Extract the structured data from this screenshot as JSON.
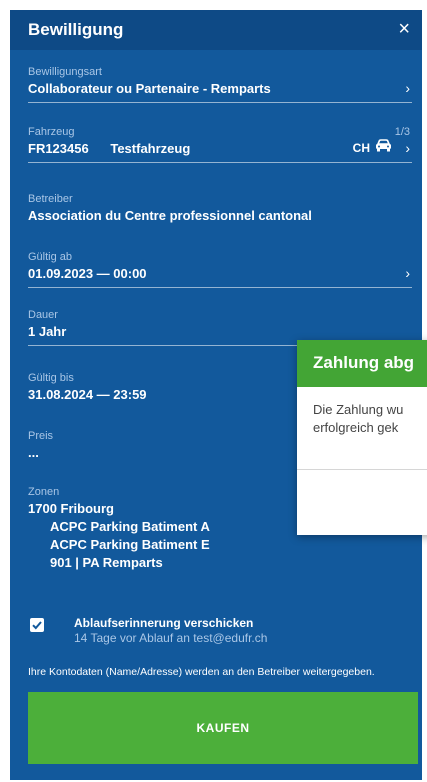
{
  "header": {
    "title": "Bewilligung",
    "close": "×"
  },
  "fields": {
    "type": {
      "label": "Bewilligungsart",
      "value": "Collaborateur ou Partenaire - Remparts"
    },
    "vehicle": {
      "label": "Fahrzeug",
      "count": "1/3",
      "plate": "FR123456",
      "name": "Testfahrzeug",
      "country": "CH"
    },
    "operator": {
      "label": "Betreiber",
      "value": "Association du Centre professionnel cantonal"
    },
    "valid_from": {
      "label": "Gültig ab",
      "value": "01.09.2023 — 00:00"
    },
    "duration": {
      "label": "Dauer",
      "value": "1 Jahr"
    },
    "valid_until": {
      "label": "Gültig bis",
      "value": "31.08.2024 — 23:59"
    },
    "price": {
      "label": "Preis",
      "value": "..."
    },
    "zones": {
      "label": "Zonen",
      "items": [
        "1700 Fribourg",
        "ACPC Parking Batiment A",
        "ACPC Parking Batiment E",
        "901 | PA Remparts"
      ]
    }
  },
  "reminder": {
    "checked": true,
    "label": "Ablaufserinnerung verschicken",
    "hint": "14 Tage vor Ablauf an test@edufr.ch"
  },
  "notice": "Ihre Kontodaten (Name/Adresse) werden an den Betreiber weitergegeben.",
  "buy_label": "KAUFEN",
  "modal": {
    "title": "Zahlung abg",
    "body_line1": "Die Zahlung wu",
    "body_line2": "erfolgreich gek"
  },
  "colors": {
    "panel": "#12599c",
    "header": "#0e4a86",
    "buy_button": "#4caf3a",
    "modal_header": "#43a535"
  }
}
